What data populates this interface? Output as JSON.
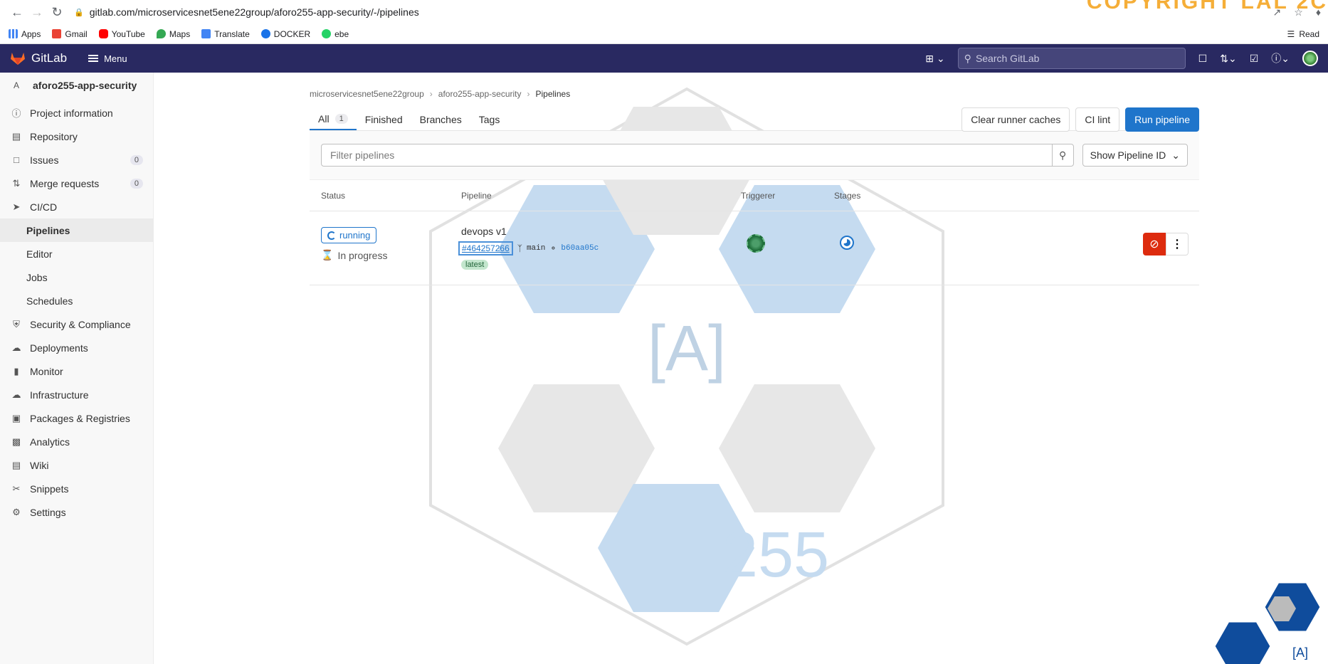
{
  "browser": {
    "url": "gitlab.com/microservicesnet5ene22group/aforo255-app-security/-/pipelines",
    "bookmarks": [
      "Apps",
      "Gmail",
      "YouTube",
      "Maps",
      "Translate",
      "DOCKER",
      "ebe"
    ],
    "reading_list": "Read",
    "watermark_text": "COPYRIGHT LAL 2C"
  },
  "gitlab": {
    "brand": "GitLab",
    "menu_label": "Menu",
    "search_placeholder": "Search GitLab"
  },
  "sidebar": {
    "project_avatar": "A",
    "project_name": "aforo255-app-security",
    "items": [
      {
        "label": "Project information",
        "icon": "info-icon"
      },
      {
        "label": "Repository",
        "icon": "book-icon"
      },
      {
        "label": "Issues",
        "icon": "issues-icon",
        "count": "0"
      },
      {
        "label": "Merge requests",
        "icon": "merge-request-icon",
        "count": "0"
      },
      {
        "label": "CI/CD",
        "icon": "rocket-icon"
      },
      {
        "label": "Pipelines",
        "sub": true,
        "active": true
      },
      {
        "label": "Editor",
        "sub": true
      },
      {
        "label": "Jobs",
        "sub": true
      },
      {
        "label": "Schedules",
        "sub": true
      },
      {
        "label": "Security & Compliance",
        "icon": "shield-icon"
      },
      {
        "label": "Deployments",
        "icon": "deployments-icon"
      },
      {
        "label": "Monitor",
        "icon": "monitor-icon"
      },
      {
        "label": "Infrastructure",
        "icon": "cloud-icon"
      },
      {
        "label": "Packages & Registries",
        "icon": "package-icon"
      },
      {
        "label": "Analytics",
        "icon": "chart-icon"
      },
      {
        "label": "Wiki",
        "icon": "wiki-icon"
      },
      {
        "label": "Snippets",
        "icon": "snippet-icon"
      },
      {
        "label": "Settings",
        "icon": "gear-icon"
      }
    ]
  },
  "breadcrumb": [
    "microservicesnet5ene22group",
    "aforo255-app-security",
    "Pipelines"
  ],
  "tabs": [
    {
      "label": "All",
      "count": "1",
      "active": true
    },
    {
      "label": "Finished"
    },
    {
      "label": "Branches"
    },
    {
      "label": "Tags"
    }
  ],
  "actions": {
    "clear_caches": "Clear runner caches",
    "ci_lint": "CI lint",
    "run_pipeline": "Run pipeline"
  },
  "filter": {
    "placeholder": "Filter pipelines",
    "dropdown": "Show Pipeline ID"
  },
  "table": {
    "headers": [
      "Status",
      "Pipeline",
      "Triggerer",
      "Stages"
    ],
    "rows": [
      {
        "status": "running",
        "duration": "In progress",
        "name": "devops v1",
        "id": "#464257266",
        "branch": "main",
        "sha": "b60aa05c",
        "tag": "latest"
      }
    ]
  },
  "watermark": {
    "letter": "[A]",
    "number": "255"
  },
  "colors": {
    "topbar": "#292961",
    "primary": "#1f75cb",
    "danger": "#dd2b0e"
  }
}
